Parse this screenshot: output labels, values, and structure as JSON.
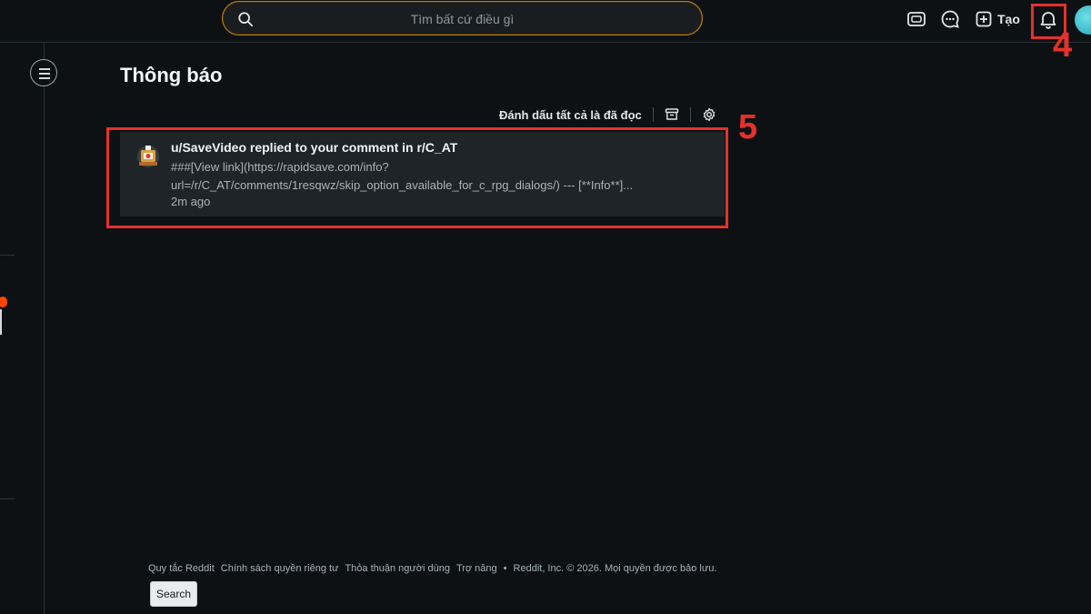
{
  "header": {
    "search_placeholder": "Tìm bất cứ điều gì",
    "create_label": "Tạo",
    "annotation_bell": "4"
  },
  "main": {
    "title": "Thông báo",
    "mark_all_read": "Đánh dấu tất cả là đã đọc",
    "annotation_notification": "5",
    "notifications": [
      {
        "title": "u/SaveVideo replied to your comment in r/C_AT",
        "body_line1": "###[View link](https://rapidsave.com/info?",
        "body_line2": "url=/r/C_AT/comments/1resqwz/skip_option_available_for_c_rpg_dialogs/) --- [**Info**]...",
        "time": "2m ago"
      }
    ]
  },
  "footer": {
    "links": [
      "Quy tắc Reddit",
      "Chính sách quyền riêng tư",
      "Thỏa thuận người dùng",
      "Trợ năng"
    ],
    "bullet": "•",
    "copyright": "Reddit, Inc. © 2026. Mọi quyền được bảo lưu.",
    "search_button": "Search"
  },
  "colors": {
    "background": "#0e1113",
    "search_border": "#c5860f",
    "annotation_red": "#e5312b",
    "notification_bg": "#1e2427",
    "accent_orange": "#ff4500"
  },
  "icons": [
    "search-icon",
    "advertise-icon",
    "chat-icon",
    "create-plus-icon",
    "bell-icon",
    "archive-icon",
    "settings-gear-icon",
    "menu-icon"
  ]
}
